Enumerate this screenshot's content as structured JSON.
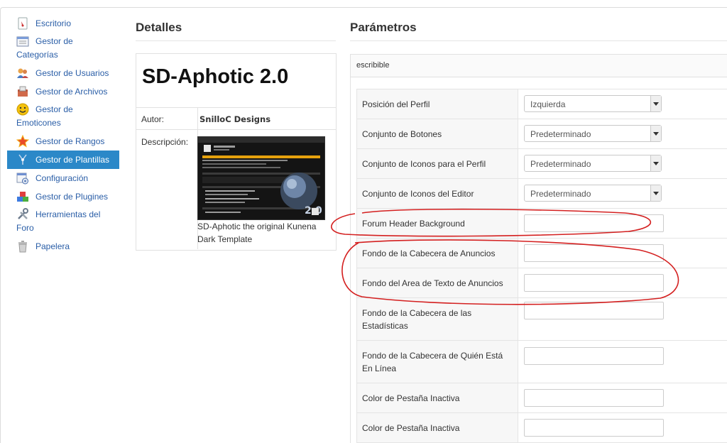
{
  "sidebar": {
    "items": [
      {
        "label": "Escritorio",
        "icon": "dashboard-icon"
      },
      {
        "label": "Gestor de Categorías",
        "icon": "categories-icon"
      },
      {
        "label": "Gestor de Usuarios",
        "icon": "users-icon"
      },
      {
        "label": "Gestor de Archivos",
        "icon": "files-icon"
      },
      {
        "label": "Gestor de Emoticones",
        "icon": "smiley-icon"
      },
      {
        "label": "Gestor de Rangos",
        "icon": "star-icon"
      },
      {
        "label": "Gestor de Plantillas",
        "icon": "templates-icon"
      },
      {
        "label": "Configuración",
        "icon": "settings-icon"
      },
      {
        "label": "Gestor de Plugines",
        "icon": "plugins-icon"
      },
      {
        "label": "Herramientas del Foro",
        "icon": "tools-icon"
      },
      {
        "label": "Papelera",
        "icon": "trash-icon"
      }
    ],
    "active": "Gestor de Plantillas",
    "active_color": "#2b88c8"
  },
  "details": {
    "title": "Detalles",
    "template_name": "SD-Aphotic 2.0",
    "author_label": "Autor:",
    "author": "SnilloC Designs",
    "description_label": "Descripción:",
    "description": "SD-Aphotic the original Kunena Dark Template"
  },
  "parameters": {
    "title": "Parámetros",
    "status": "escribible",
    "rows": [
      {
        "label": "Posición del Perfil",
        "type": "select",
        "value": "Izquierda"
      },
      {
        "label": "Conjunto de Botones",
        "type": "select",
        "value": "Predeterminado"
      },
      {
        "label": "Conjunto de Iconos para el Perfil",
        "type": "select",
        "value": "Predeterminado"
      },
      {
        "label": "Conjunto de Iconos del Editor",
        "type": "select",
        "value": "Predeterminado"
      },
      {
        "label": "Forum Header Background",
        "type": "text",
        "value": ""
      },
      {
        "label": "Fondo de la Cabecera de Anuncios",
        "type": "text",
        "value": ""
      },
      {
        "label": "Fondo del Area de Texto de Anuncios",
        "type": "text",
        "value": ""
      },
      {
        "label": "Fondo de la Cabecera de las Estadísticas",
        "type": "text",
        "value": ""
      },
      {
        "label": "Fondo de la Cabecera de Quién Está En Línea",
        "type": "text",
        "value": ""
      },
      {
        "label": "Color de Pestaña Inactiva",
        "type": "text",
        "value": ""
      },
      {
        "label": "Color de Pestaña Inactiva",
        "type": "text",
        "value": ""
      }
    ]
  },
  "annotation_color": "#d42020"
}
